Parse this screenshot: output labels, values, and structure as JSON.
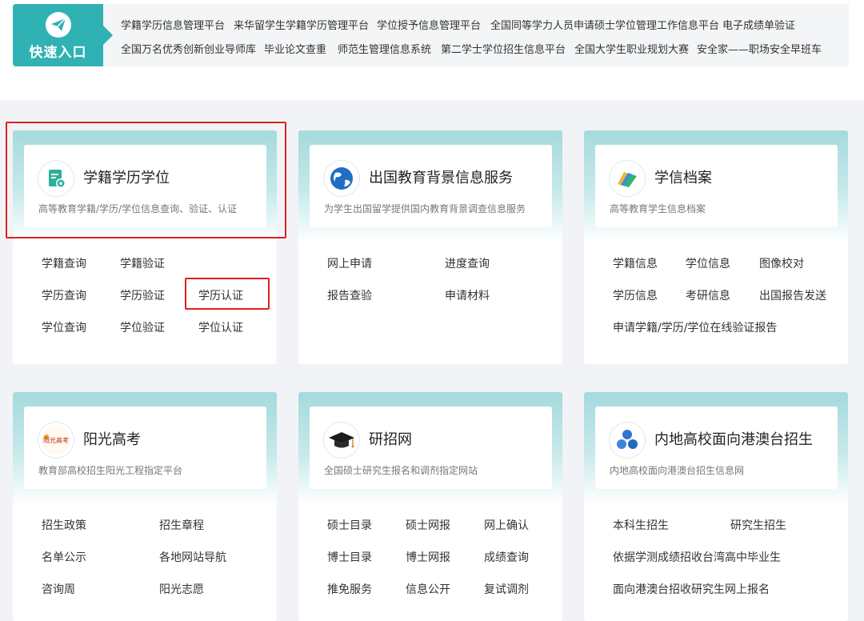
{
  "quick_entry": {
    "label": "快速入口",
    "links_row1": [
      "学籍学历信息管理平台",
      "来华留学生学籍学历管理平台",
      "学位授予信息管理平台",
      "全国同等学力人员申请硕士学位管理工作信息平台",
      "电子成绩单验证"
    ],
    "links_row2": [
      "全国万名优秀创新创业导师库",
      "毕业论文查重",
      "师范生管理信息系统",
      "第二学士学位招生信息平台",
      "全国大学生职业规划大赛",
      "安全家——职场安全早班车"
    ]
  },
  "cards": [
    {
      "title": "学籍学历学位",
      "desc": "高等教育学籍/学历/学位信息查询、验证、认证",
      "links": [
        "学籍查询",
        "学籍验证",
        "学历查询",
        "学历验证",
        "学历认证",
        "学位查询",
        "学位验证",
        "学位认证"
      ]
    },
    {
      "title": "出国教育背景信息服务",
      "desc": "为学生出国留学提供国内教育背景调查信息服务",
      "links": [
        "网上申请",
        "进度查询",
        "报告查验",
        "申请材料"
      ]
    },
    {
      "title": "学信档案",
      "desc": "高等教育学生信息档案",
      "links": [
        "学籍信息",
        "学位信息",
        "图像校对",
        "学历信息",
        "考研信息",
        "出国报告发送",
        "申请学籍/学历/学位在线验证报告"
      ]
    },
    {
      "title": "阳光高考",
      "desc": "教育部高校招生阳光工程指定平台",
      "logo_text": "阳光高考",
      "links": [
        "招生政策",
        "招生章程",
        "名单公示",
        "各地网站导航",
        "咨询周",
        "阳光志愿"
      ]
    },
    {
      "title": "研招网",
      "desc": "全国硕士研究生报名和调剂指定网站",
      "links": [
        "硕士目录",
        "硕士网报",
        "网上确认",
        "博士目录",
        "博士网报",
        "成绩查询",
        "推免服务",
        "信息公开",
        "复试调剂"
      ]
    },
    {
      "title": "内地高校面向港澳台招生",
      "desc": "内地高校面向港澳台招生信息网",
      "links": [
        "本科生招生",
        "研究生招生",
        "依据学测成绩招收台湾高中毕业生",
        "面向港澳台招收研究生网上报名"
      ]
    }
  ],
  "colors": {
    "accent": "#30b2b4",
    "highlight": "#e02020",
    "band": "#a5dadd"
  },
  "icons": [
    "paper-plane-icon",
    "document-star-icon",
    "globe-icon",
    "folder-stack-icon",
    "sunshine-logo-icon",
    "graduation-cap-icon",
    "flower-dots-icon"
  ]
}
